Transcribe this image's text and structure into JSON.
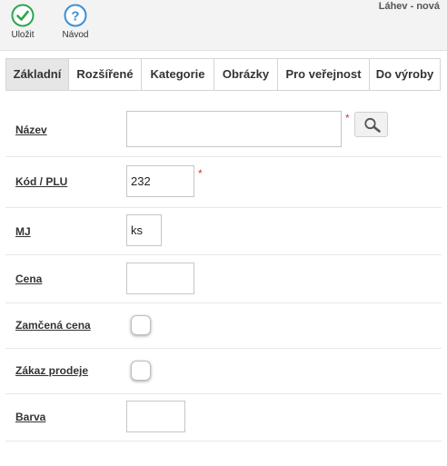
{
  "toolbar": {
    "save_label": "Uložit",
    "help_label": "Návod",
    "save_color": "#2aa84a",
    "help_color": "#3a8fd6"
  },
  "window": {
    "title": "Láhev - nová"
  },
  "tabs": [
    {
      "label": "Základní",
      "active": true
    },
    {
      "label": "Rozšířené"
    },
    {
      "label": "Kategorie"
    },
    {
      "label": "Obrázky"
    },
    {
      "label": "Pro veřejnost"
    },
    {
      "label": "Do výroby"
    }
  ],
  "form": {
    "name": {
      "label": "Název",
      "value": "",
      "required_mark": "*"
    },
    "code": {
      "label": "Kód / PLU",
      "value": "232",
      "required_mark": "*"
    },
    "unit": {
      "label": "MJ",
      "value": "ks"
    },
    "price": {
      "label": "Cena",
      "value": ""
    },
    "locked_price": {
      "label": "Zamčená cena",
      "checked": false
    },
    "sale_ban": {
      "label": "Zákaz prodeje",
      "checked": false
    },
    "color": {
      "label": "Barva",
      "value": ""
    }
  },
  "icons": {
    "save": "check-circle-icon",
    "help": "question-circle-icon",
    "search": "magnifier-icon"
  },
  "colors": {
    "required": "#e03030",
    "active_tab": "#e6e6e6"
  }
}
